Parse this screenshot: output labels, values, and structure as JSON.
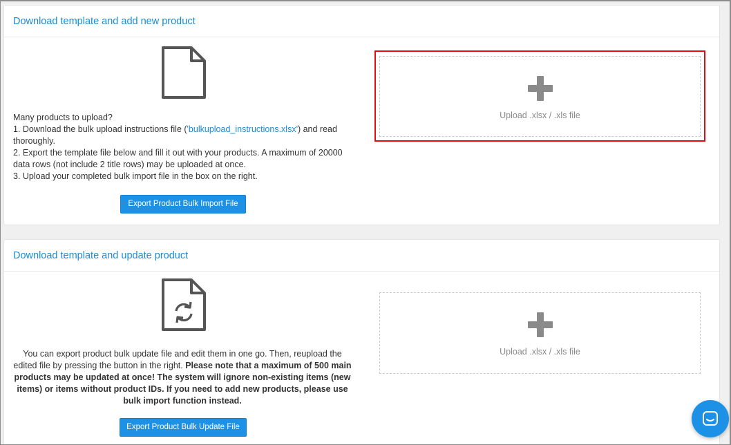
{
  "new_product": {
    "title": "Download template and add new product",
    "intro": "Many products to upload?",
    "step1_prefix": "1. Download the bulk upload instructions file (",
    "step1_link": "'bulkupload_instructions.xlsx'",
    "step1_suffix": ") and read thoroughly.",
    "step2": "2. Export the template file below and fill it out with your products. A maximum of 20000 data rows (not include 2 title rows) may be uploaded at once.",
    "step3": "3. Upload your completed bulk import file in the box on the right.",
    "button_label": "Export Product Bulk Import File",
    "upload_label": "Upload .xlsx / .xls file",
    "icon": "file-icon"
  },
  "update_product": {
    "title": "Download template and update product",
    "desc_normal": "You can export product bulk update file and edit them in one go. Then, reupload the edited file by pressing the button in the right. ",
    "desc_bold": "Please note that a maximum of 500 main products may be updated at once! The system will ignore non-existing items (new items) or items without product IDs. If you need to add new products, please use bulk import function instead.",
    "button_label": "Export Product Bulk Update File",
    "upload_label": "Upload .xlsx / .xls file",
    "icon": "file-refresh-icon"
  },
  "chat": {
    "icon": "chat-icon"
  },
  "colors": {
    "accent": "#1d91e6",
    "link": "#1a8bd6",
    "highlight": "#e30d0d"
  }
}
